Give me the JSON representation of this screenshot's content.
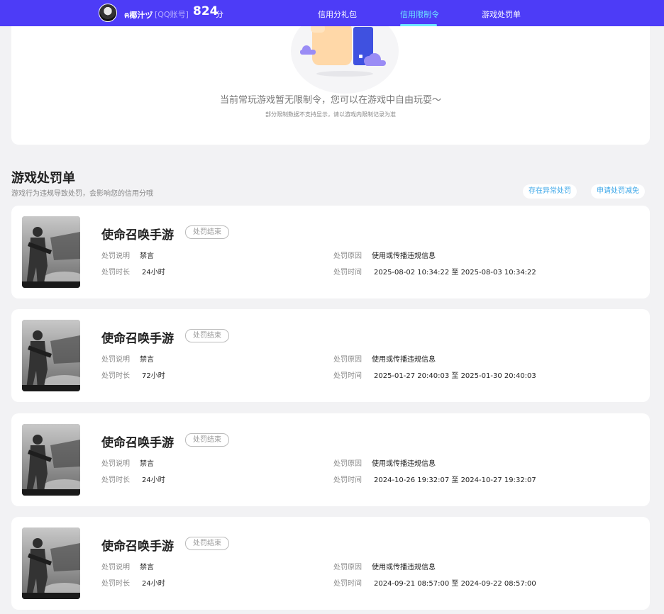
{
  "header": {
    "nickname": "ฅ椰汁ヅ",
    "account_label": "[QQ账号]",
    "score": "824",
    "score_unit": "分",
    "nav": [
      {
        "label": "信用分礼包",
        "active": false
      },
      {
        "label": "信用限制令",
        "active": true
      },
      {
        "label": "游戏处罚单",
        "active": false
      }
    ]
  },
  "restriction": {
    "message": "当前常玩游戏暂无限制令，您可以在游戏中自由玩耍～",
    "note": "部分限制数据不支持显示，请以游戏内限制记录为准"
  },
  "penalties": {
    "title": "游戏处罚单",
    "description": "游戏行为违规导致处罚，会影响您的信用分哦",
    "abnormal_button": "存在异常处罚",
    "reduce_button": "申请处罚减免",
    "labels": {
      "explain": "处罚说明",
      "duration": "处罚时长",
      "reason": "处罚原因",
      "time": "处罚时间"
    },
    "items": [
      {
        "game": "使命召唤手游",
        "status": "处罚结束",
        "explain": "禁言",
        "duration": "24小时",
        "reason": "使用或传播违规信息",
        "time": "2025-08-02 10:34:22 至 2025-08-03 10:34:22"
      },
      {
        "game": "使命召唤手游",
        "status": "处罚结束",
        "explain": "禁言",
        "duration": "72小时",
        "reason": "使用或传播违规信息",
        "time": "2025-01-27 20:40:03 至 2025-01-30 20:40:03"
      },
      {
        "game": "使命召唤手游",
        "status": "处罚结束",
        "explain": "禁言",
        "duration": "24小时",
        "reason": "使用或传播违规信息",
        "time": "2024-10-26 19:32:07 至 2024-10-27 19:32:07"
      },
      {
        "game": "使命召唤手游",
        "status": "处罚结束",
        "explain": "禁言",
        "duration": "24小时",
        "reason": "使用或传播违规信息",
        "time": "2024-09-21 08:57:00 至 2024-09-22 08:57:00"
      }
    ]
  },
  "colors": {
    "nav_bg": "#4d3cf7",
    "nav_active": "#6ee7ff",
    "link": "#3aa6e8",
    "page_bg": "#f2f2f4"
  }
}
